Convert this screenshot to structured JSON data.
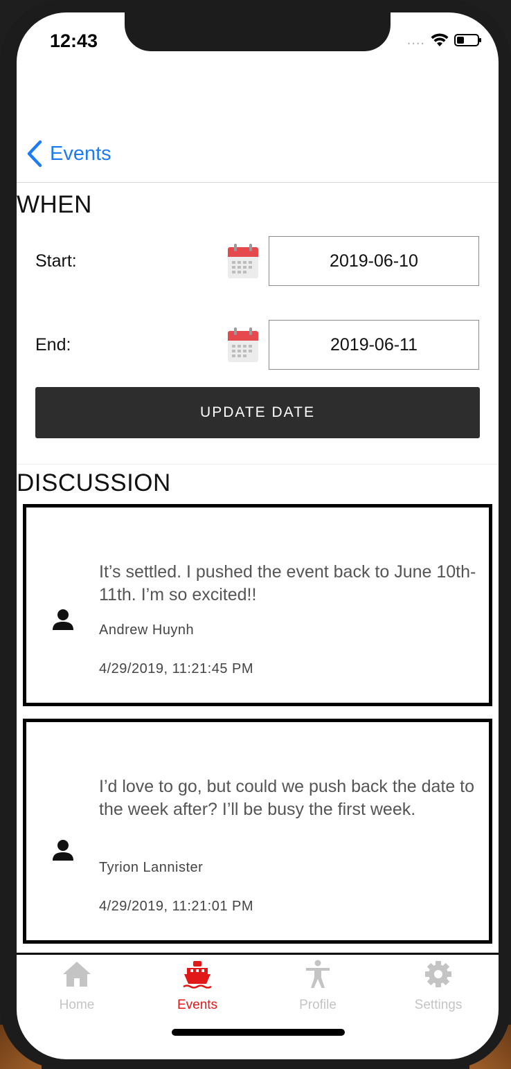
{
  "status_bar": {
    "time": "12:43",
    "signal_dots": "....",
    "wifi_icon": "wifi-icon",
    "battery_icon": "battery-icon"
  },
  "nav": {
    "back_label": "Events",
    "back_icon": "chevron-left-icon"
  },
  "when": {
    "title": "WHEN",
    "start_label": "Start:",
    "start_value": "2019-06-10",
    "end_label": "End:",
    "end_value": "2019-06-11",
    "calendar_icon": "calendar-icon",
    "update_button": "UPDATE DATE"
  },
  "discussion": {
    "title": "DISCUSSION",
    "comments": [
      {
        "text": "It’s settled. I pushed the event back to June 10th-11th. I’m so excited!!",
        "author": "Andrew Huynh",
        "timestamp": "4/29/2019, 11:21:45 PM"
      },
      {
        "text": "I’d love to go, but could we push back the date to the week after? I’ll be busy the first week.",
        "author": "Tyrion Lannister",
        "timestamp": "4/29/2019, 11:21:01 PM"
      }
    ]
  },
  "tabs": [
    {
      "label": "Home",
      "icon": "home-icon",
      "active": false
    },
    {
      "label": "Events",
      "icon": "ship-icon",
      "active": true
    },
    {
      "label": "Profile",
      "icon": "person-accessibility-icon",
      "active": false
    },
    {
      "label": "Settings",
      "icon": "gear-icon",
      "active": false
    }
  ],
  "colors": {
    "accent_blue": "#1e7cf2",
    "active_tab_red": "#e01818",
    "button_dark": "#2d2d2d",
    "inactive_tab": "#c4c4c4"
  }
}
